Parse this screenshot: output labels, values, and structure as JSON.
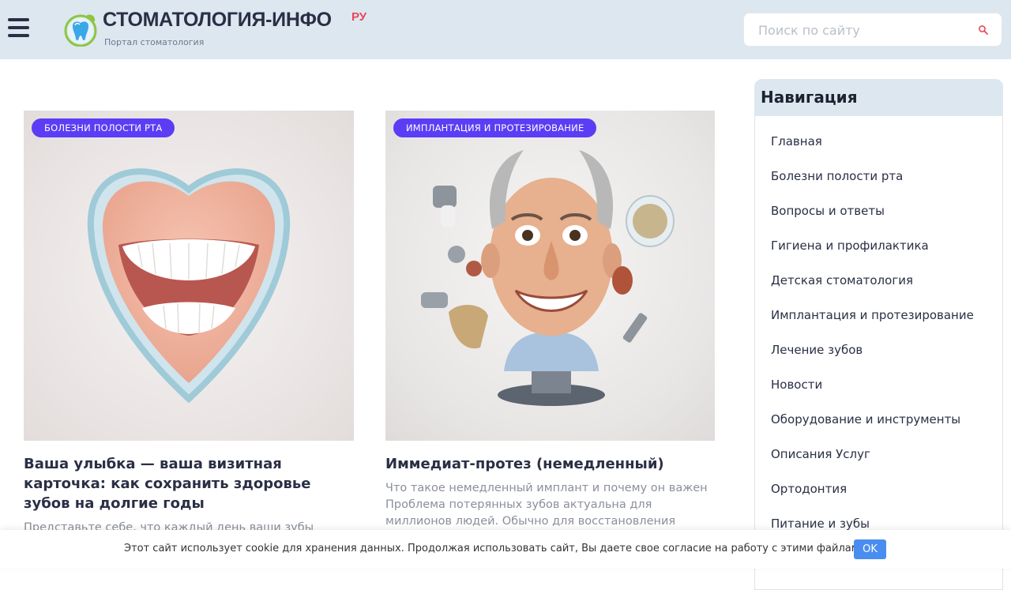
{
  "header": {
    "logo_title": "СТОМАТОЛОГИЯ-ИНФО",
    "logo_suffix": "РУ",
    "logo_subtitle": "Портал стоматология",
    "search_placeholder": "Поиск по сайту"
  },
  "colors": {
    "header_bg": "#dde7f0",
    "badge_bg": "#5b3df5",
    "brand_accent": "#e8475f",
    "ok_button": "#4a8df0"
  },
  "cards": [
    {
      "badge": "БОЛЕЗНИ ПОЛОСТИ РТА",
      "title": "Ваша улыбка — ваша визитная карточка: как сохранить здоровье зубов на долгие годы",
      "excerpt": "Представьте себе, что каждый день ваши зубы"
    },
    {
      "badge": "ИМПЛАНТАЦИЯ И ПРОТЕЗИРОВАНИЕ",
      "title": "Иммедиат-протез (немедленный)",
      "excerpt": "Что такое немедленный имплант и почему он важен Проблема потерянных зубов актуальна для миллионов людей. Обычно для восстановления"
    }
  ],
  "sidebar": {
    "title": "Навигация",
    "items": [
      {
        "label": "Главная"
      },
      {
        "label": "Болезни полости рта"
      },
      {
        "label": "Вопросы и ответы"
      },
      {
        "label": "Гигиена и профилактика"
      },
      {
        "label": "Детская стоматология"
      },
      {
        "label": "Имплантация и протезирование"
      },
      {
        "label": "Лечение зубов"
      },
      {
        "label": "Новости"
      },
      {
        "label": "Оборудование и инструменты"
      },
      {
        "label": "Описания Услуг"
      },
      {
        "label": "Ортодонтия"
      },
      {
        "label": "Питание и зубы"
      }
    ]
  },
  "cookie": {
    "text": "Этот сайт использует cookie для хранения данных. Продолжая использовать сайт, Вы даете свое согласие на работу с этими файлами.",
    "ok_label": "OK"
  },
  "icons": [
    "menu-icon",
    "tooth-logo-icon",
    "search-icon"
  ]
}
